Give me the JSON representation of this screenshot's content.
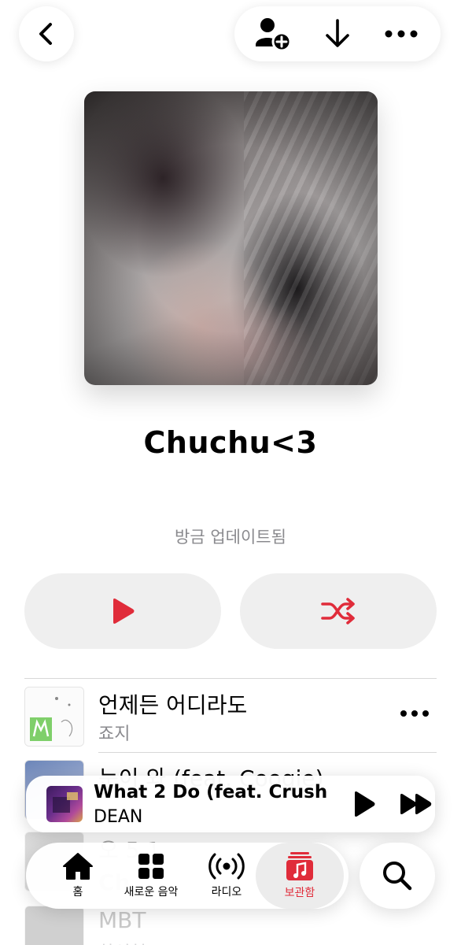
{
  "colors": {
    "accent": "#e02c3a",
    "secondary_text": "#8a8a8e"
  },
  "header": {
    "back_icon": "chevron-left-icon",
    "add_person_icon": "person-add-icon",
    "download_icon": "download-arrow-icon",
    "more_icon": "ellipsis-icon"
  },
  "playlist": {
    "title": "Chuchu<3",
    "subtitle": "방금 업데이트됨"
  },
  "actions": {
    "play_icon": "play-icon",
    "shuffle_icon": "shuffle-icon"
  },
  "tracks": [
    {
      "title": "언제든 어디라도",
      "artist": "죠지"
    },
    {
      "title": "눈이 와 (feat. Coogie)",
      "artist": ""
    },
    {
      "title": "오 5 1",
      "artist": ""
    },
    {
      "title": "Ch",
      "artist": ""
    },
    {
      "title": "MBT",
      "artist": "하성현"
    }
  ],
  "now_playing": {
    "title": "What 2 Do (feat. Crush",
    "artist": "DEAN"
  },
  "tabs": [
    {
      "label": "홈",
      "icon": "home-icon"
    },
    {
      "label": "새로운 음악",
      "icon": "grid-icon"
    },
    {
      "label": "라디오",
      "icon": "radio-broadcast-icon"
    },
    {
      "label": "보관함",
      "icon": "library-music-icon",
      "active": true
    }
  ],
  "search_icon": "search-icon"
}
